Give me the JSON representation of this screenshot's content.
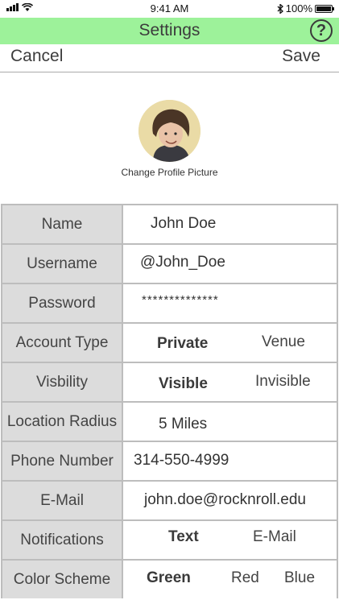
{
  "status_bar": {
    "time": "9:41 AM",
    "battery": "100%",
    "battery_level": 1.0
  },
  "header": {
    "title": "Settings",
    "help_label": "?"
  },
  "nav": {
    "cancel_label": "Cancel",
    "save_label": "Save"
  },
  "profile": {
    "caption": "Change Profile Picture"
  },
  "fields": {
    "name": {
      "label": "Name",
      "value": "John Doe"
    },
    "username": {
      "label": "Username",
      "value": "@John_Doe"
    },
    "password": {
      "label": "Password",
      "value": "**************"
    },
    "account_type": {
      "label": "Account Type",
      "options": [
        "Private",
        "Venue"
      ],
      "selected": "Private"
    },
    "visibility": {
      "label": "Visbility",
      "options": [
        "Visible",
        "Invisible"
      ],
      "selected": "Visible"
    },
    "location_radius": {
      "label": "Location Radius",
      "value": "5 Miles"
    },
    "phone": {
      "label": "Phone Number",
      "value": "314-550-4999"
    },
    "email": {
      "label": "E-Mail",
      "value": "john.doe@rocknroll.edu"
    },
    "notifications": {
      "label": "Notifications",
      "options": [
        "Text",
        "E-Mail"
      ],
      "selected": "Text"
    },
    "color_scheme": {
      "label": "Color Scheme",
      "options": [
        "Green",
        "Red",
        "Blue"
      ],
      "selected": "Green"
    }
  },
  "colors": {
    "header_bg": "#9df29a",
    "label_bg": "#dcdcdc",
    "border": "#bdbdbd"
  }
}
